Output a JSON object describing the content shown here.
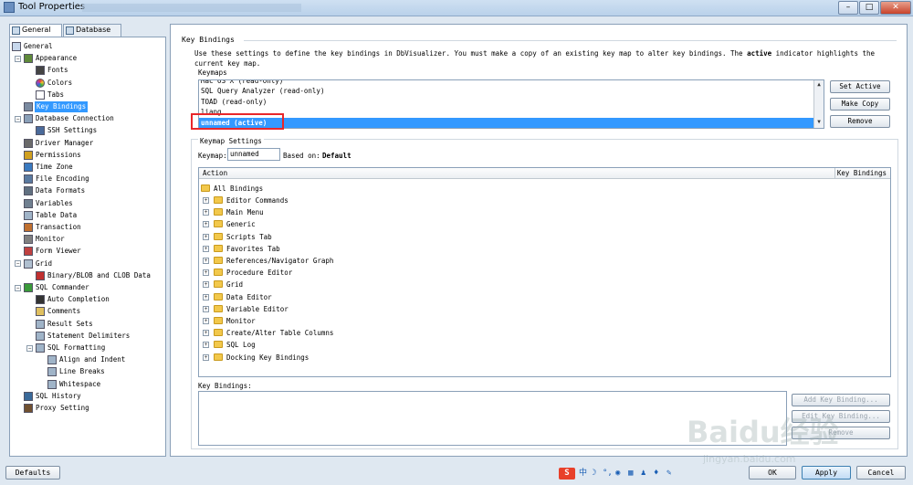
{
  "window": {
    "title": "Tool Properties"
  },
  "tabs": [
    {
      "label": "General"
    },
    {
      "label": "Database"
    }
  ],
  "tree": [
    {
      "label": "General",
      "level": 0,
      "icon": "page-icon"
    },
    {
      "label": "Appearance",
      "level": 1,
      "icon": "brush-icon"
    },
    {
      "label": "Fonts",
      "level": 2,
      "icon": "font-icon"
    },
    {
      "label": "Colors",
      "level": 2,
      "icon": "color-wheel-icon"
    },
    {
      "label": "Tabs",
      "level": 2,
      "icon": "tabs-icon"
    },
    {
      "label": "Key Bindings",
      "level": 1,
      "icon": "keyboard-icon",
      "selected": true
    },
    {
      "label": "Database Connection",
      "level": 1,
      "icon": "database-icon"
    },
    {
      "label": "SSH Settings",
      "level": 2,
      "icon": "ssh-icon"
    },
    {
      "label": "Driver Manager",
      "level": 1,
      "icon": "driver-icon"
    },
    {
      "label": "Permissions",
      "level": 1,
      "icon": "key-icon"
    },
    {
      "label": "Time Zone",
      "level": 1,
      "icon": "globe-icon"
    },
    {
      "label": "File Encoding",
      "level": 1,
      "icon": "file-icon"
    },
    {
      "label": "Data Formats",
      "level": 1,
      "icon": "format-icon"
    },
    {
      "label": "Variables",
      "level": 1,
      "icon": "variables-icon"
    },
    {
      "label": "Table Data",
      "level": 1,
      "icon": "table-icon"
    },
    {
      "label": "Transaction",
      "level": 1,
      "icon": "transaction-icon"
    },
    {
      "label": "Monitor",
      "level": 1,
      "icon": "monitor-icon"
    },
    {
      "label": "Form Viewer",
      "level": 1,
      "icon": "form-icon"
    },
    {
      "label": "Grid",
      "level": 1,
      "icon": "grid-icon"
    },
    {
      "label": "Binary/BLOB and CLOB Data",
      "level": 2,
      "icon": "blob-icon"
    },
    {
      "label": "SQL Commander",
      "level": 1,
      "icon": "play-icon"
    },
    {
      "label": "Auto Completion",
      "level": 2,
      "icon": "completion-icon"
    },
    {
      "label": "Comments",
      "level": 2,
      "icon": "comments-icon"
    },
    {
      "label": "Result Sets",
      "level": 2,
      "icon": "resultset-icon"
    },
    {
      "label": "Statement Delimiters",
      "level": 2,
      "icon": "delimiter-icon"
    },
    {
      "label": "SQL Formatting",
      "level": 2,
      "icon": "formatting-icon"
    },
    {
      "label": "Align and Indent",
      "level": 3,
      "icon": "align-icon"
    },
    {
      "label": "Line Breaks",
      "level": 3,
      "icon": "linebreak-icon"
    },
    {
      "label": "Whitespace",
      "level": 3,
      "icon": "whitespace-icon"
    },
    {
      "label": "SQL History",
      "level": 1,
      "icon": "history-icon"
    },
    {
      "label": "Proxy Setting",
      "level": 1,
      "icon": "proxy-icon"
    }
  ],
  "main": {
    "section_title": "Key Bindings",
    "description_1": "Use these settings to define the key bindings in DbVisualizer. You must make a copy of an existing key map to alter key bindings. The ",
    "description_bold": "active",
    "description_2": " indicator highlights the",
    "description_3": "current key map.",
    "keymaps_label": "Keymaps",
    "keymaps": [
      {
        "label": "Mac OS X  (read-only)"
      },
      {
        "label": "SQL Query Analyzer  (read-only)"
      },
      {
        "label": "TOAD  (read-only)"
      },
      {
        "label": "liang"
      },
      {
        "label": "unnamed  (active)",
        "active": true
      }
    ],
    "buttons": {
      "set_active": "Set Active",
      "make_copy": "Make Copy",
      "remove": "Remove"
    },
    "keymap_settings_label": "Keymap Settings",
    "keymap_field_label": "Keymap:",
    "keymap_field_value": "unnamed",
    "based_on_label": "Based on:",
    "based_on_value": "Default",
    "table": {
      "col_action": "Action",
      "col_key_bindings": "Key Bindings",
      "root": "All Bindings",
      "rows": [
        "Editor Commands",
        "Main Menu",
        "Generic",
        "Scripts Tab",
        "Favorites Tab",
        "References/Navigator Graph",
        "Procedure Editor",
        "Grid",
        "Data Editor",
        "Variable Editor",
        "Monitor",
        "Create/Alter Table Columns",
        "SQL Log",
        "Docking Key Bindings"
      ]
    },
    "key_bindings_label": "Key Bindings:",
    "kb_buttons": {
      "add": "Add Key Binding...",
      "edit": "Edit Key Binding...",
      "remove": "Remove"
    }
  },
  "bottom": {
    "defaults": "Defaults",
    "ok": "OK",
    "apply": "Apply",
    "cancel": "Cancel"
  },
  "ime": {
    "s_label": "S",
    "zh_label": "中"
  },
  "watermark": {
    "text": "Baidu经验",
    "url": "jingyan.baidu.com"
  },
  "colors": {
    "selection": "#3399ff",
    "highlight_box": "#e8262a"
  }
}
